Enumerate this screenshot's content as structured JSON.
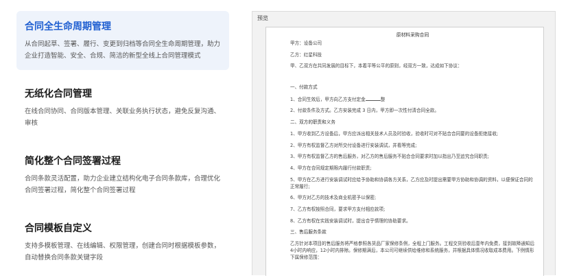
{
  "features": [
    {
      "title": "合同全生命周期管理",
      "desc": "从合同起草、签署、履行、变更到归档等合同全生命周期管理，助力企业打造智能、安全、合规、简洁的新型全线上合同管理模式",
      "active": true
    },
    {
      "title": "无纸化合同管理",
      "desc": "在线合同协同、合同版本管理、关联业务执行状态，避免反复沟通、审核",
      "active": false
    },
    {
      "title": "简化整个合同签署过程",
      "desc": "合同条款灵活配置，助力企业建立结构化电子合同条款库，合理优化合同签署过程，简化整个合同签署过程",
      "active": false
    },
    {
      "title": "合同模板自定义",
      "desc": "支持多模板管理、在线编辑、权限管理，创建合同时根据模板参数，自动替换合同条款关键字段",
      "active": false
    }
  ],
  "preview": {
    "label": "预览",
    "doc": {
      "title": "原材料采购合同",
      "party_a": "甲方：设备公司",
      "party_b": "乙方：红星科技",
      "intro": "甲、乙双方在共同发展的目标下，本着平等公平的原则，经双方一致，达成如下协议：",
      "sections": [
        {
          "heading": "一、付款方式",
          "items": [
            "1、合同生效后，甲方向乙方支付定金",
            "2、付款条件及方式。乙方安装完成 3 日内，甲方即一次性付清合同全款。"
          ],
          "blank_suffix": "整"
        },
        {
          "heading": "二、双方的职责和义务",
          "items": [
            "1、甲方收到乙方设备后，甲方应派出相关技术人员及时验收，验收时可对不贴合合同要的设备拒绝接收;",
            "2、甲方有权监督乙方对所交付设备进行安装调试，并看等完成;",
            "3、甲方有权监督乙方的售后服务，对乙方的售后服务不贴合合同要求时加以指出乃至追究合同职责;",
            "4、甲方在合同规定期限内履行付款职责;",
            "5、甲方在乙方进行安装调试时应给予协助和协调各方关系，乙方应及时提出需要甲方协助和协调的资料，以便保证合同的正常履行;",
            "6、甲方对乙方的技术及商业机密予以保密;",
            "7、乙方有权按照合同，要求甲方支付相应款项;",
            "8、乙方有权在实践安装调试时，提出合乎情理的协助要求。"
          ]
        },
        {
          "heading": "三、售后服务条款",
          "items": [
            "乙方针对本项目的售后服务将严格参照各货品厂家保修条例，全程上门服务。工程交货验收后壹年内免费，接到故障通知后4小时内响应，12小时内排除。保修期满后，本公司可继续供给维修和系统服务，并根据具体情况收取成本费用。下例情形下属保修范围："
          ]
        }
      ]
    }
  }
}
